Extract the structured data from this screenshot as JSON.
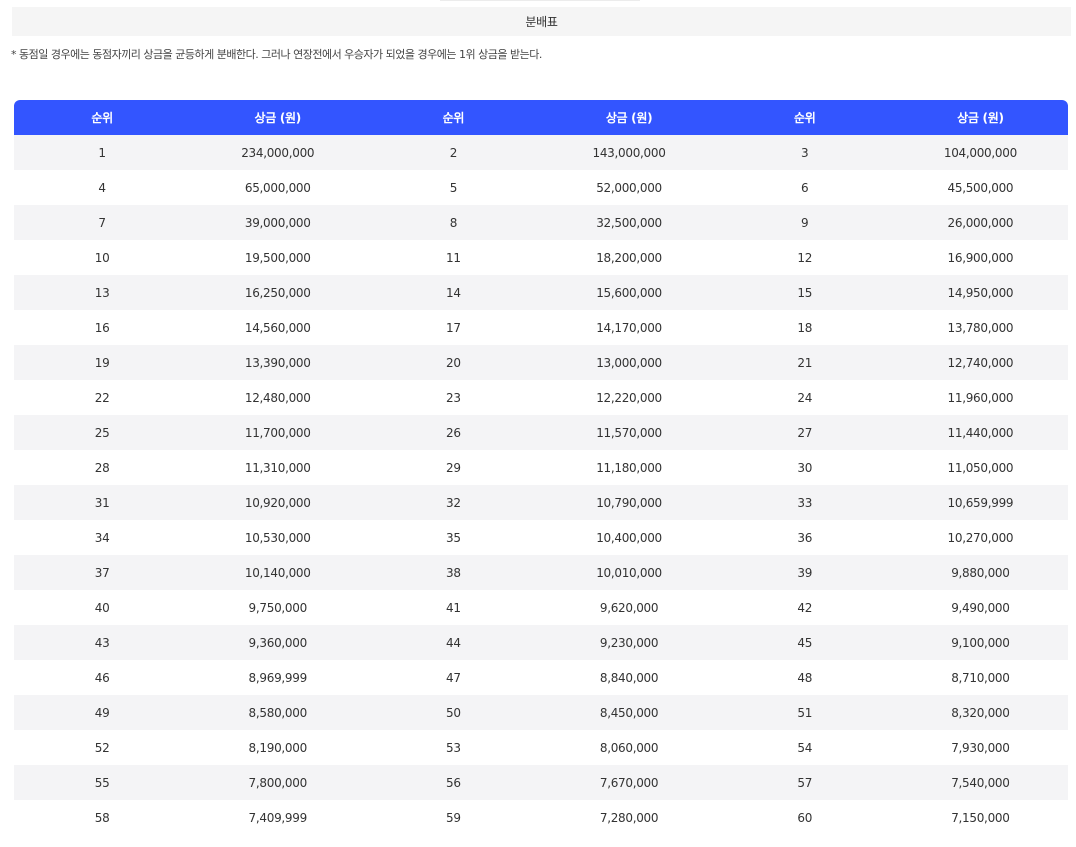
{
  "title": "분배표",
  "note": "* 동점일 경우에는 동점자끼리 상금을 균등하게 분배한다. 그러나 연장전에서 우승자가 되었을 경우에는 1위 상금을 받는다.",
  "table": {
    "headers": [
      "순위",
      "상금 (원)",
      "순위",
      "상금 (원)",
      "순위",
      "상금 (원)"
    ],
    "rows": [
      [
        "1",
        "234,000,000",
        "2",
        "143,000,000",
        "3",
        "104,000,000"
      ],
      [
        "4",
        "65,000,000",
        "5",
        "52,000,000",
        "6",
        "45,500,000"
      ],
      [
        "7",
        "39,000,000",
        "8",
        "32,500,000",
        "9",
        "26,000,000"
      ],
      [
        "10",
        "19,500,000",
        "11",
        "18,200,000",
        "12",
        "16,900,000"
      ],
      [
        "13",
        "16,250,000",
        "14",
        "15,600,000",
        "15",
        "14,950,000"
      ],
      [
        "16",
        "14,560,000",
        "17",
        "14,170,000",
        "18",
        "13,780,000"
      ],
      [
        "19",
        "13,390,000",
        "20",
        "13,000,000",
        "21",
        "12,740,000"
      ],
      [
        "22",
        "12,480,000",
        "23",
        "12,220,000",
        "24",
        "11,960,000"
      ],
      [
        "25",
        "11,700,000",
        "26",
        "11,570,000",
        "27",
        "11,440,000"
      ],
      [
        "28",
        "11,310,000",
        "29",
        "11,180,000",
        "30",
        "11,050,000"
      ],
      [
        "31",
        "10,920,000",
        "32",
        "10,790,000",
        "33",
        "10,659,999"
      ],
      [
        "34",
        "10,530,000",
        "35",
        "10,400,000",
        "36",
        "10,270,000"
      ],
      [
        "37",
        "10,140,000",
        "38",
        "10,010,000",
        "39",
        "9,880,000"
      ],
      [
        "40",
        "9,750,000",
        "41",
        "9,620,000",
        "42",
        "9,490,000"
      ],
      [
        "43",
        "9,360,000",
        "44",
        "9,230,000",
        "45",
        "9,100,000"
      ],
      [
        "46",
        "8,969,999",
        "47",
        "8,840,000",
        "48",
        "8,710,000"
      ],
      [
        "49",
        "8,580,000",
        "50",
        "8,450,000",
        "51",
        "8,320,000"
      ],
      [
        "52",
        "8,190,000",
        "53",
        "8,060,000",
        "54",
        "7,930,000"
      ],
      [
        "55",
        "7,800,000",
        "56",
        "7,670,000",
        "57",
        "7,540,000"
      ],
      [
        "58",
        "7,409,999",
        "59",
        "7,280,000",
        "60",
        "7,150,000"
      ]
    ]
  },
  "colors": {
    "header_bg": "#3355ff",
    "row_stripe": "#f4f4f6",
    "title_bg": "#f5f5f5"
  }
}
